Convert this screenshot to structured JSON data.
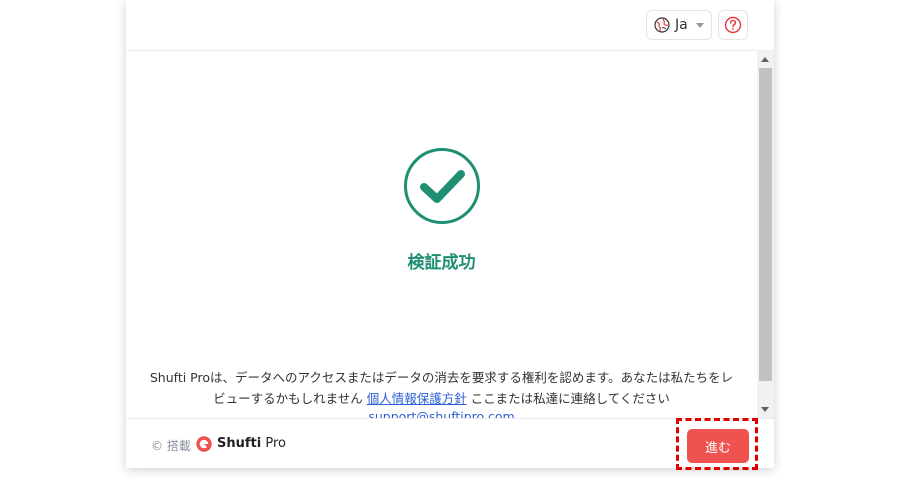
{
  "header": {
    "language_label": "Ja"
  },
  "main": {
    "success_title": "検証成功",
    "privacy_text_before": "Shufti Proは、データへのアクセスまたはデータの消去を要求する権利を認めます。あなたは私たちをレビューするかもしれません",
    "privacy_link": "個人情報保護方針",
    "privacy_text_after": " ここまたは私達に連絡してください",
    "email_link": "support@shuftipro.com"
  },
  "footer": {
    "powered_by": "© 搭載",
    "brand_strong": "Shufti",
    "brand_light": " Pro",
    "next_label": "進む"
  },
  "colors": {
    "accent_green": "#1f8f74",
    "button_red": "#ef5350",
    "highlight_red": "#e00000",
    "link_blue": "#2c5fd6"
  },
  "icons": [
    "globe-icon",
    "caret-down-icon",
    "help-icon",
    "check-circle-icon",
    "shuftipro-logo-icon"
  ]
}
